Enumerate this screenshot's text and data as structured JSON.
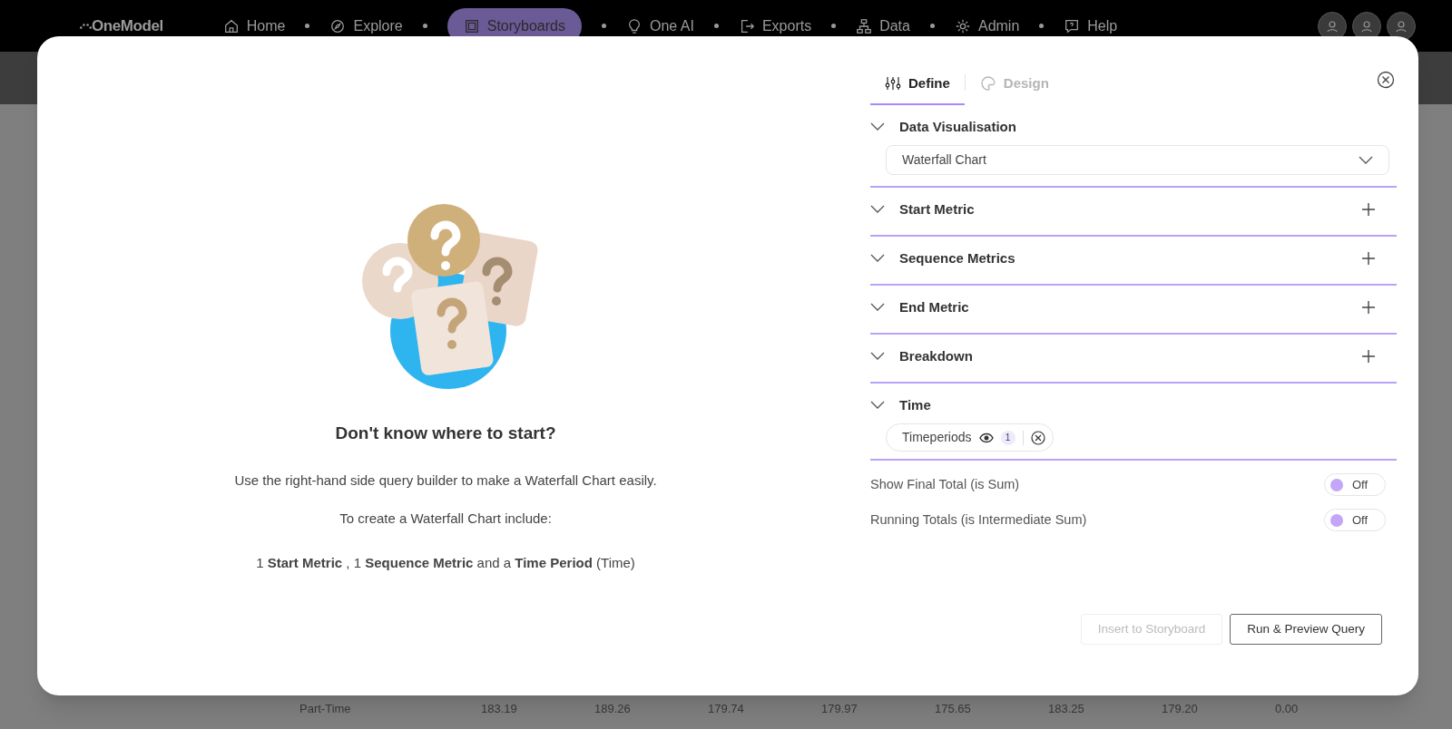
{
  "nav": {
    "logo": "OneModel",
    "items": [
      {
        "label": "Home",
        "selected": false
      },
      {
        "label": "Explore",
        "selected": false
      },
      {
        "label": "Storyboards",
        "selected": true
      },
      {
        "label": "One AI",
        "selected": false
      },
      {
        "label": "Exports",
        "selected": false
      },
      {
        "label": "Data",
        "selected": false
      },
      {
        "label": "Admin",
        "selected": false
      },
      {
        "label": "Help",
        "selected": false
      }
    ]
  },
  "background_table": {
    "rows": [
      [
        "Part-Time",
        "183.19",
        "189.26",
        "179.74",
        "179.97",
        "175.65",
        "183.25",
        "179.20",
        "0.00"
      ]
    ]
  },
  "empty_state": {
    "title": "Don't know where to start?",
    "lines": [
      "Use the right-hand side query builder to make a Waterfall Chart easily.",
      "To create a Waterfall Chart include:",
      "1 **Start Metric** , 1 **Sequence Metric** and a **Time Period** (Time)"
    ]
  },
  "tabs": [
    {
      "label": "Define",
      "selected": true,
      "disabled": false
    },
    {
      "label": "Design",
      "selected": false,
      "disabled": true
    }
  ],
  "sections": [
    {
      "title": "Data Visualisation",
      "kind": "select",
      "value": "Waterfall Chart"
    },
    {
      "title": "Start Metric",
      "kind": "add"
    },
    {
      "title": "Sequence Metrics",
      "kind": "add"
    },
    {
      "title": "End Metric",
      "kind": "add"
    },
    {
      "title": "Breakdown",
      "kind": "add"
    },
    {
      "title": "Time",
      "kind": "chips",
      "chips": [
        {
          "label": "Timeperiods",
          "count": "1"
        }
      ]
    }
  ],
  "toggles": [
    {
      "label": "Show Final Total (is Sum)",
      "state": "Off",
      "on": false
    },
    {
      "label": "Running Totals (is Intermediate Sum)",
      "state": "Off",
      "on": false
    }
  ],
  "buttons": [
    {
      "label": "Insert to Storyboard",
      "disabled": true
    },
    {
      "label": "Run & Preview Query",
      "disabled": false
    }
  ]
}
